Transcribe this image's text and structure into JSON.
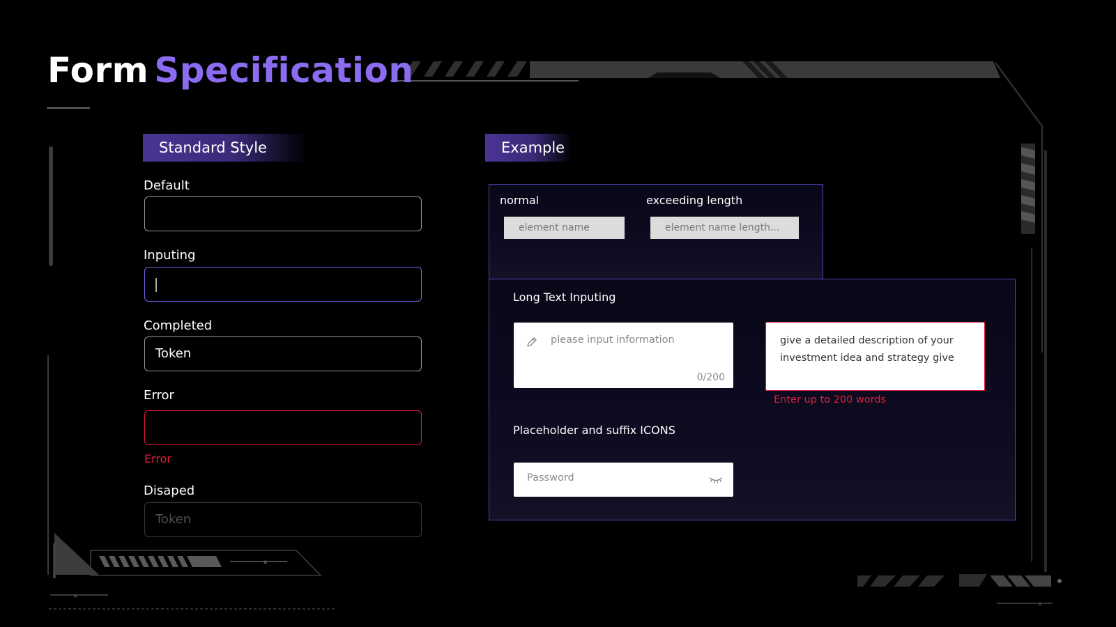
{
  "title": {
    "part1": "Form",
    "part2": "Specification"
  },
  "standard": {
    "header": "Standard Style",
    "default_label": "Default",
    "inputing_label": "Inputing",
    "completed_label": "Completed",
    "completed_value": "Token",
    "error_label": "Error",
    "error_message": "Error",
    "disabled_label": "Disaped",
    "disabled_value": "Token"
  },
  "example": {
    "header": "Example",
    "normal_label": "normal",
    "normal_value": "element name",
    "exceeding_label": "exceeding length",
    "exceeding_value": "element name length...",
    "long_text_label": "Long Text Inputing",
    "long_placeholder": "please input information",
    "long_counter": "0/200",
    "long_error_text": "give a detailed description of your investment idea and strategy give",
    "long_error_message": "Enter up to 200 words",
    "suffix_label": "Placeholder and suffix ICONS",
    "password_placeholder": "Password"
  },
  "colors": {
    "accent": "#8b6cf0",
    "focus_border": "#7b63e8",
    "error": "#e21d3a",
    "panel_border": "#4d47b8"
  },
  "icons": {
    "pencil": "pencil-icon",
    "eye_closed": "eye-closed-icon"
  }
}
